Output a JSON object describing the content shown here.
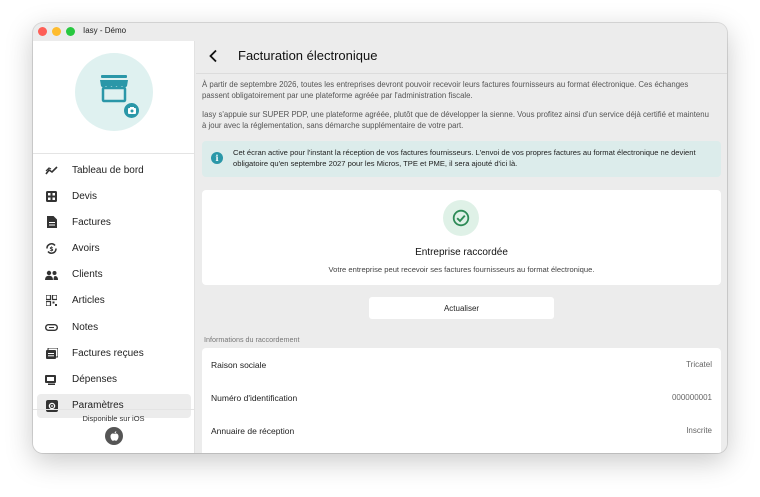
{
  "window": {
    "title": "Iasy - Démo"
  },
  "sidebar": {
    "items": [
      {
        "label": "Tableau de bord",
        "icon": "dashboard-chart-icon",
        "active": false
      },
      {
        "label": "Devis",
        "icon": "calculator-icon",
        "active": false
      },
      {
        "label": "Factures",
        "icon": "document-icon",
        "active": false
      },
      {
        "label": "Avoirs",
        "icon": "credit-refresh-icon",
        "active": false
      },
      {
        "label": "Clients",
        "icon": "people-icon",
        "active": false
      },
      {
        "label": "Articles",
        "icon": "qr-code-icon",
        "active": false
      },
      {
        "label": "Notes",
        "icon": "link-pill-icon",
        "active": false
      },
      {
        "label": "Factures reçues",
        "icon": "inbox-documents-icon",
        "active": false
      },
      {
        "label": "Dépenses",
        "icon": "receipt-icon",
        "active": false
      },
      {
        "label": "Paramètres",
        "icon": "settings-box-icon",
        "active": true
      }
    ],
    "ios_text": "Disponible sur iOS"
  },
  "page": {
    "title": "Facturation électronique",
    "intro_1": "À partir de septembre 2026, toutes les entreprises devront pouvoir recevoir leurs factures fournisseurs au format électronique. Ces échanges passent obligatoirement par une plateforme agréée par l'administration fiscale.",
    "intro_2": "Iasy s'appuie sur SUPER PDP, une plateforme agréée, plutôt que de développer la sienne. Vous profitez ainsi d'un service déjà certifié et maintenu à jour avec la réglementation, sans démarche supplémentaire de votre part.",
    "info": "Cet écran active pour l'instant la réception de vos factures fournisseurs. L'envoi de vos propres factures au format électronique ne devient obligatoire qu'en septembre 2027 pour les Micros, TPE et PME, il sera ajouté d'ici là.",
    "status": {
      "title": "Entreprise raccordée",
      "description": "Votre entreprise peut recevoir ses factures fournisseurs au format électronique."
    },
    "refresh_label": "Actualiser",
    "section_label": "Informations du raccordement",
    "details": [
      {
        "key": "Raison sociale",
        "value": "Tricatel"
      },
      {
        "key": "Numéro d'identification",
        "value": "000000001"
      },
      {
        "key": "Annuaire de réception",
        "value": "Inscrite"
      }
    ]
  },
  "colors": {
    "accent": "#2a97a8",
    "success": "#2e8b57",
    "info_bg": "#dceceb"
  }
}
